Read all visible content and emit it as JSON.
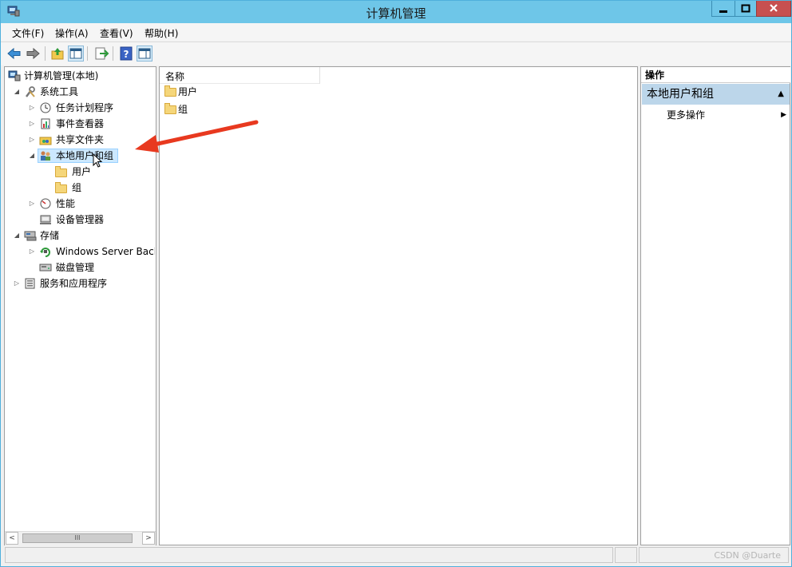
{
  "window": {
    "title": "计算机管理"
  },
  "menu": [
    "文件(F)",
    "操作(A)",
    "查看(V)",
    "帮助(H)"
  ],
  "toolbar": {
    "icons": [
      "back-arrow-icon",
      "forward-arrow-icon",
      "up-folder-icon",
      "show-hide-console-tree-icon",
      "export-list-icon",
      "help-icon",
      "show-hide-action-pane-icon"
    ]
  },
  "tree": {
    "root": "计算机管理(本地)",
    "system_tools": "系统工具",
    "task_scheduler": "任务计划程序",
    "event_viewer": "事件查看器",
    "shared_folders": "共享文件夹",
    "local_users_groups": "本地用户和组",
    "users": "用户",
    "groups": "组",
    "performance": "性能",
    "device_manager": "设备管理器",
    "storage": "存储",
    "windows_server_backup": "Windows Server Back",
    "disk_management": "磁盘管理",
    "services_apps": "服务和应用程序"
  },
  "list": {
    "column_name": "名称",
    "items": [
      "用户",
      "组"
    ]
  },
  "actions": {
    "header": "操作",
    "section": "本地用户和组",
    "more": "更多操作"
  },
  "status": {
    "watermark": "CSDN @Duarte"
  },
  "colors": {
    "titlebar": "#6ec6e8",
    "close_button": "#c75050",
    "selection": "#cce8ff",
    "actions_section": "#bcd6ea",
    "annotation_arrow": "#e8391f"
  }
}
